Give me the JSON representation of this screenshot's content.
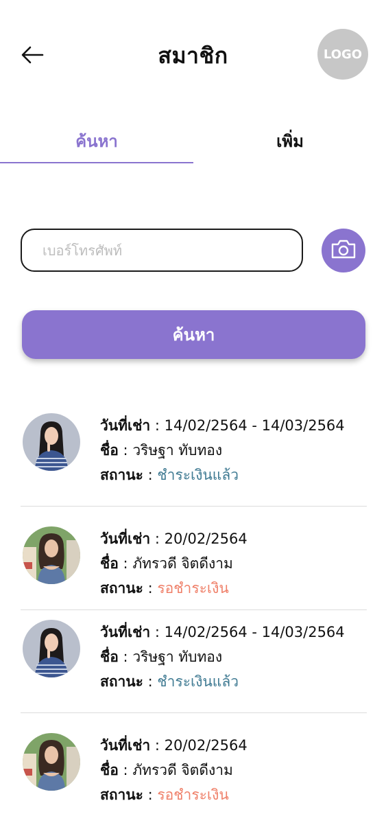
{
  "header": {
    "title": "สมาชิก",
    "logo_text": "LOGO"
  },
  "tabs": [
    {
      "label": "ค้นหา",
      "active": true
    },
    {
      "label": "เพิ่ม",
      "active": false
    }
  ],
  "search": {
    "placeholder": "เบอร์โทรศัพท์",
    "value": "",
    "button_label": "ค้นหา"
  },
  "labels": {
    "rent_date": "วันที่เช่า",
    "name": "ชื่อ",
    "status": "สถานะ",
    "separator": " : "
  },
  "colors": {
    "accent": "#8a74cf",
    "paid": "#3f7a92",
    "unpaid": "#ef7f68",
    "logo_bg": "#c7c7c7"
  },
  "members": [
    {
      "rent_date": "14/02/2564 - 14/03/2564",
      "name": "วริษฐา ทับทอง",
      "status": "ชำระเงินแล้ว",
      "status_type": "paid",
      "avatar": "woman-striped-sweater-avatar"
    },
    {
      "rent_date": "20/02/2564",
      "name": "ภัทรวดี จิตดีงาม",
      "status": "รอชำระเงิน",
      "status_type": "unpaid",
      "avatar": "woman-blue-top-avatar"
    },
    {
      "rent_date": "14/02/2564 - 14/03/2564",
      "name": "วริษฐา ทับทอง",
      "status": "ชำระเงินแล้ว",
      "status_type": "paid",
      "avatar": "woman-striped-sweater-avatar"
    },
    {
      "rent_date": "20/02/2564",
      "name": "ภัทรวดี จิตดีงาม",
      "status": "รอชำระเงิน",
      "status_type": "unpaid",
      "avatar": "woman-blue-top-avatar"
    }
  ]
}
